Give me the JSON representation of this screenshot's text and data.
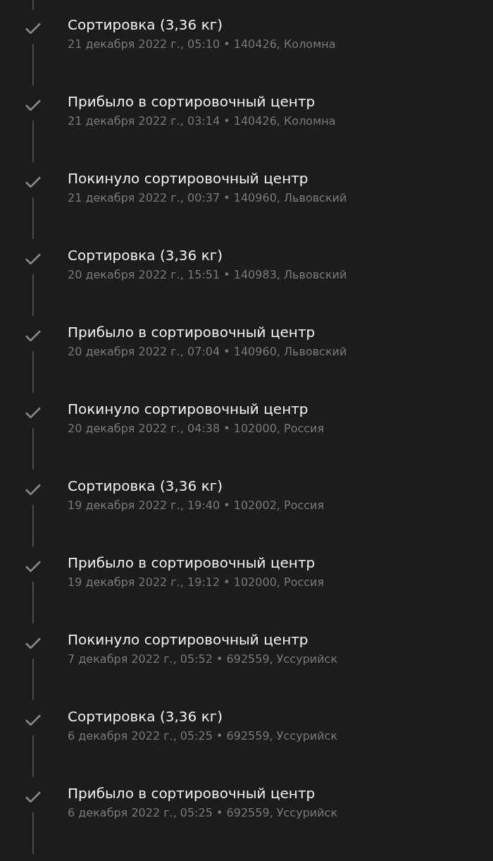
{
  "events": [
    {
      "title": "Сортировка (3,36 кг)",
      "details": "21 декабря 2022 г., 05:10 • 140426, Коломна",
      "done": true
    },
    {
      "title": "Прибыло в сортировочный центр",
      "details": "21 декабря 2022 г., 03:14 • 140426, Коломна",
      "done": true
    },
    {
      "title": "Покинуло сортировочный центр",
      "details": "21 декабря 2022 г., 00:37 • 140960, Львовский",
      "done": true
    },
    {
      "title": "Сортировка (3,36 кг)",
      "details": "20 декабря 2022 г., 15:51 • 140983, Львовский",
      "done": true
    },
    {
      "title": "Прибыло в сортировочный центр",
      "details": "20 декабря 2022 г., 07:04 • 140960, Львовский",
      "done": true
    },
    {
      "title": "Покинуло сортировочный центр",
      "details": "20 декабря 2022 г., 04:38 • 102000, Россия",
      "done": true
    },
    {
      "title": "Сортировка (3,36 кг)",
      "details": "19 декабря 2022 г., 19:40 • 102002, Россия",
      "done": true
    },
    {
      "title": "Прибыло в сортировочный центр",
      "details": "19 декабря 2022 г., 19:12 • 102000, Россия",
      "done": true
    },
    {
      "title": "Покинуло сортировочный центр",
      "details": "7 декабря 2022 г., 05:52 • 692559, Уссурийск",
      "done": true
    },
    {
      "title": "Сортировка (3,36 кг)",
      "details": "6 декабря 2022 г., 05:25 • 692559, Уссурийск",
      "done": true
    },
    {
      "title": "Прибыло в сортировочный центр",
      "details": "6 декабря 2022 г., 05:25 • 692559, Уссурийск",
      "done": true
    }
  ]
}
